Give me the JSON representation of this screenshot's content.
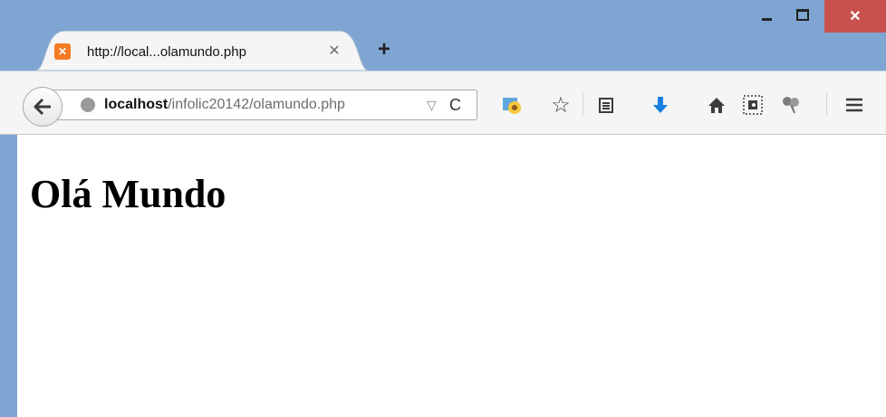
{
  "tab": {
    "title": "http://local...olamundo.php",
    "close": "✕"
  },
  "new_tab": "+",
  "window_controls": {
    "close": "✕"
  },
  "url": {
    "host": "localhost",
    "path": "/infolic20142/olamundo.php"
  },
  "toolbar": {
    "reload": "C",
    "dropmarker": "▽",
    "icons": [
      "addon-icon",
      "bookmark-star-icon",
      "reading-list-icon",
      "download-icon",
      "home-icon",
      "evernote-icon",
      "shield-addon-icon",
      "menu-icon"
    ]
  },
  "page": {
    "heading": "Olá Mundo"
  },
  "colors": {
    "frame": "#7fa5d3",
    "close_button": "#c9514d",
    "download_blue": "#1a7fe2",
    "favicon": "#f57a24"
  }
}
